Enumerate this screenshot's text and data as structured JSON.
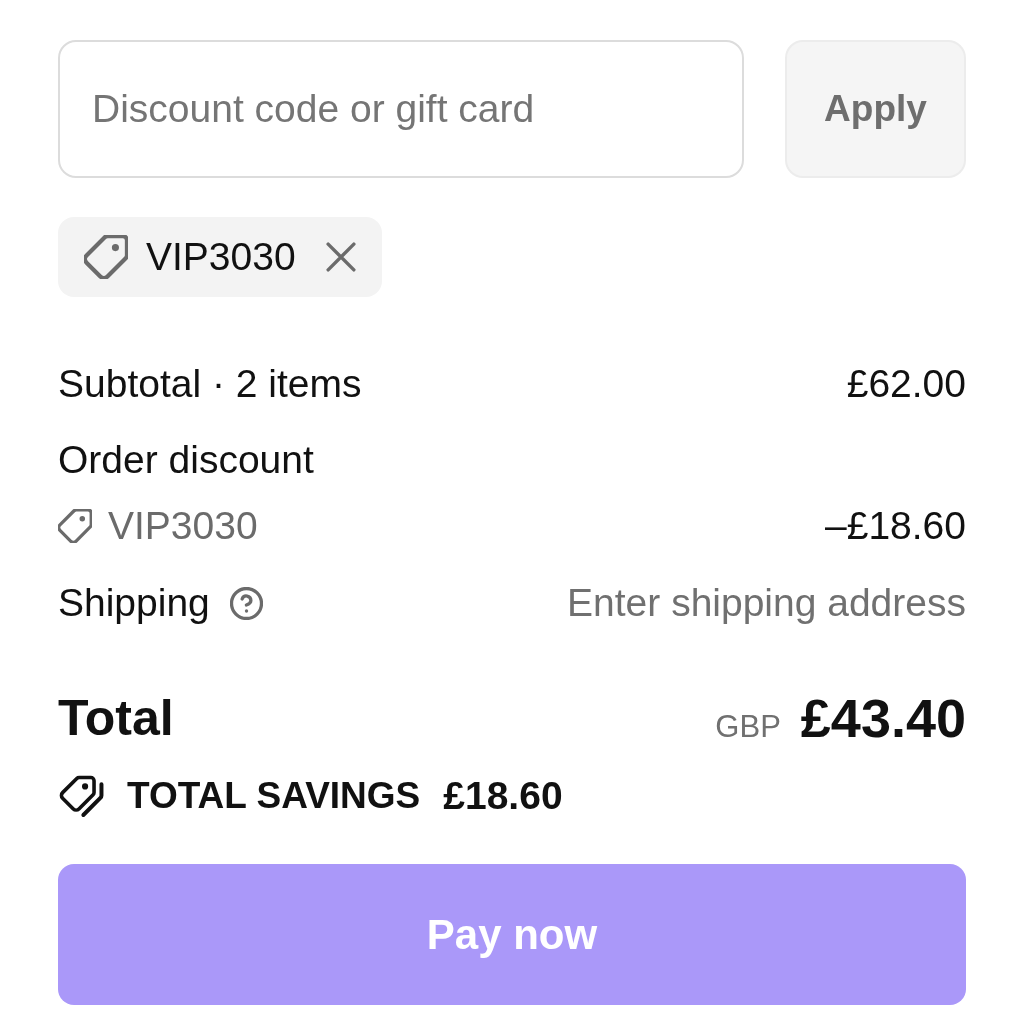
{
  "discount_field": {
    "placeholder": "Discount code or gift card"
  },
  "apply_button": {
    "label": "Apply",
    "disabled": true
  },
  "applied_codes": [
    {
      "code": "VIP3030"
    }
  ],
  "summary": {
    "rows": [
      {
        "kind": "subtotal",
        "label": "Subtotal · 2 items",
        "value": "£62.00"
      },
      {
        "kind": "discount",
        "label": "Order discount",
        "code": "VIP3030",
        "value": "–£18.60"
      },
      {
        "kind": "shipping",
        "label": "Shipping",
        "value": "Enter shipping address"
      }
    ]
  },
  "total": {
    "label": "Total",
    "currency": "GBP",
    "amount": "£43.40"
  },
  "savings": {
    "label": "TOTAL SAVINGS",
    "amount": "£18.60"
  },
  "pay_button": {
    "label": "Pay now",
    "disabled": true
  }
}
